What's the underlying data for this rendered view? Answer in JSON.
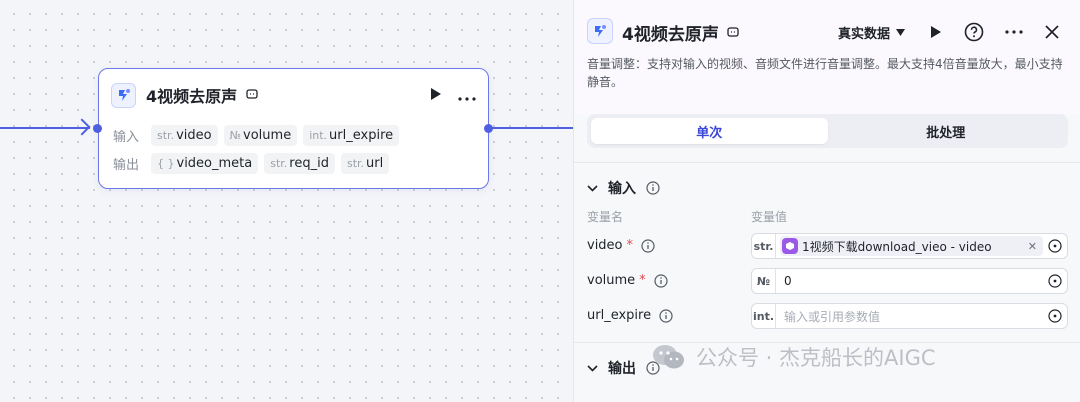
{
  "node": {
    "title": "4视频去原声",
    "input_label": "输入",
    "output_label": "输出",
    "inputs": [
      {
        "type": "str.",
        "name": "video"
      },
      {
        "type": "№",
        "name": "volume"
      },
      {
        "type": "int.",
        "name": "url_expire"
      }
    ],
    "outputs": [
      {
        "type": "{ }",
        "name": "video_meta"
      },
      {
        "type": "str.",
        "name": "req_id"
      },
      {
        "type": "str.",
        "name": "url"
      }
    ]
  },
  "panel": {
    "title": "4视频去原声",
    "mode": "真实数据",
    "description": "音量调整：支持对输入的视频、音频文件进行音量调整。最大支持4倍音量放大，最小支持静音。",
    "tabs": {
      "single": "单次",
      "batch": "批处理"
    },
    "input_section": "输入",
    "col_name": "变量名",
    "col_value": "变量值",
    "params": [
      {
        "name": "video",
        "required": "*",
        "type": "str.",
        "ref": "1视频下载download_vieo - video"
      },
      {
        "name": "volume",
        "required": "*",
        "type": "№",
        "value": "0"
      },
      {
        "name": "url_expire",
        "type": "int.",
        "placeholder": "输入或引用参数值"
      }
    ],
    "output_section": "输出"
  },
  "watermark": "公众号 · 杰克船长的AIGC",
  "colors": {
    "accent": "#4e5fe0",
    "ref_icon": "#9b59e8",
    "required": "#e5484d"
  }
}
